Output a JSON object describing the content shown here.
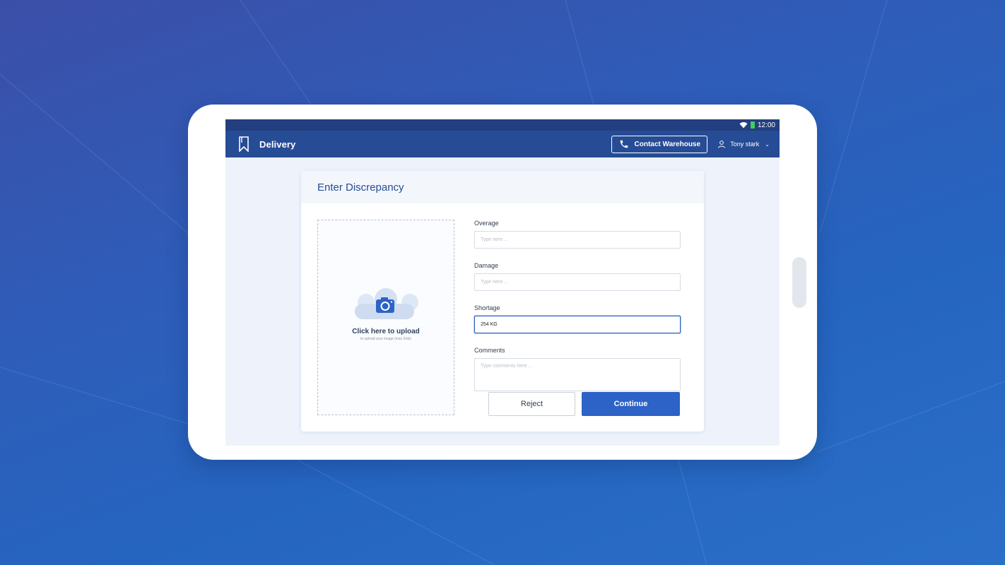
{
  "status_bar": {
    "time": "12:00"
  },
  "app_bar": {
    "title": "Delivery",
    "contact_button": "Contact Warehouse",
    "user_name": "Tony stark",
    "user_menu_icon": "chevron-down-icon"
  },
  "card": {
    "title": "Enter Discrepancy",
    "upload": {
      "title": "Click here to upload",
      "subtitle": "to upload your image (max 2mb)"
    },
    "fields": {
      "overage": {
        "label": "Overage",
        "placeholder": "Type here ...",
        "value": ""
      },
      "damage": {
        "label": "Damage",
        "placeholder": "Type here ...",
        "value": ""
      },
      "shortage": {
        "label": "Shortage",
        "placeholder": "Type here ...",
        "value": "254 KG"
      },
      "comments": {
        "label": "Comments",
        "placeholder": "Type comments here ...",
        "value": ""
      }
    },
    "actions": {
      "reject": "Reject",
      "continue": "Continue"
    }
  },
  "colors": {
    "app_bar": "#264c95",
    "status_bar": "#233f7f",
    "primary": "#2d62c6",
    "screen_bg": "#eef3fb"
  }
}
